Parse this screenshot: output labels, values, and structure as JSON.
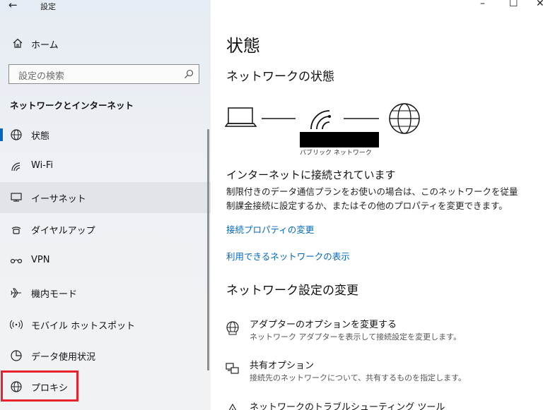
{
  "window": {
    "title": "設定",
    "back_icon": "back-arrow-icon",
    "minimize": "–",
    "maximize": "☐",
    "close": "✕"
  },
  "sidebar": {
    "home_label": "ホーム",
    "search_placeholder": "設定の検索",
    "section_title": "ネットワークとインターネット",
    "items": [
      {
        "label": "状態",
        "icon": "status-globe-icon",
        "active": true
      },
      {
        "label": "Wi-Fi",
        "icon": "wifi-icon"
      },
      {
        "label": "イーサネット",
        "icon": "ethernet-icon"
      },
      {
        "label": "ダイヤルアップ",
        "icon": "dialup-icon"
      },
      {
        "label": "VPN",
        "icon": "vpn-icon"
      },
      {
        "label": "機内モード",
        "icon": "airplane-icon"
      },
      {
        "label": "モバイル ホットスポット",
        "icon": "hotspot-icon"
      },
      {
        "label": "データ使用状況",
        "icon": "data-usage-icon"
      },
      {
        "label": "プロキシ",
        "icon": "globe-icon"
      }
    ]
  },
  "main": {
    "page_title": "状態",
    "network_status_heading": "ネットワークの状態",
    "network_type": "パブリック ネットワーク",
    "connection_title": "インターネットに接続されています",
    "connection_desc_line1": "制限付きのデータ通信プランをお使いの場合は、このネットワークを従量",
    "connection_desc_line2": "制課金接続に設定するか、またはその他のプロパティを変更できます。",
    "link_properties": "接続プロパティの変更",
    "link_available": "利用できるネットワークの表示",
    "change_heading": "ネットワーク設定の変更",
    "options": [
      {
        "title": "アダプターのオプションを変更する",
        "desc": "ネットワーク アダプターを表示して接続設定を変更します。",
        "icon": "adapter-icon"
      },
      {
        "title": "共有オプション",
        "desc": "接続先のネットワークについて、共有するものを指定します。",
        "icon": "sharing-icon"
      },
      {
        "title": "ネットワークのトラブルシューティング ツール",
        "desc": "",
        "icon": "troubleshoot-icon"
      }
    ]
  },
  "colors": {
    "accent": "#0067c0",
    "highlight": "#e8212b"
  }
}
